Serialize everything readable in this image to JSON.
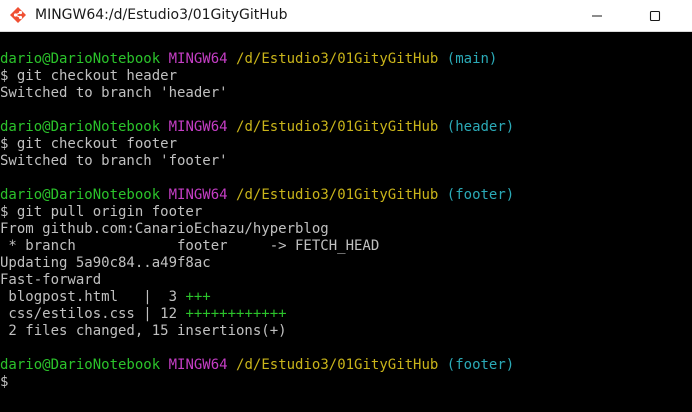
{
  "window": {
    "title": "MINGW64:/d/Estudio3/01GityGitHub",
    "minimize_icon": "minimize-icon",
    "maximize_icon": "maximize-icon",
    "app_icon": "mingw-app-icon"
  },
  "colors": {
    "background": "#000000",
    "text": "#c0c0c0",
    "user": "#2bc32b",
    "system": "#c53ec5",
    "path": "#c9b41a",
    "branch": "#2baab7",
    "plus": "#2bc32b"
  },
  "prompt": {
    "user": "dario@DarioNotebook",
    "system": "MINGW64",
    "path": "/d/Estudio3/01GityGitHub"
  },
  "blocks": {
    "b1": {
      "branch": "(main)",
      "command": "$ git checkout header",
      "output": [
        "Switched to branch 'header'"
      ]
    },
    "b2": {
      "branch": "(header)",
      "command": "$ git checkout footer",
      "output": [
        "Switched to branch 'footer'"
      ]
    },
    "b3": {
      "branch": "(footer)",
      "command": "$ git pull origin footer",
      "output": [
        "From github.com:CanarioEchazu/hyperblog",
        " * branch            footer     -> FETCH_HEAD",
        "Updating 5a90c84..a49f8ac",
        "Fast-forward"
      ],
      "stats": [
        {
          "text": " blogpost.html   |  3 ",
          "plus": "+++"
        },
        {
          "text": " css/estilos.css | 12 ",
          "plus": "++++++++++++"
        }
      ],
      "summary": " 2 files changed, 15 insertions(+)"
    },
    "b4": {
      "branch": "(footer)",
      "command": "$"
    }
  }
}
